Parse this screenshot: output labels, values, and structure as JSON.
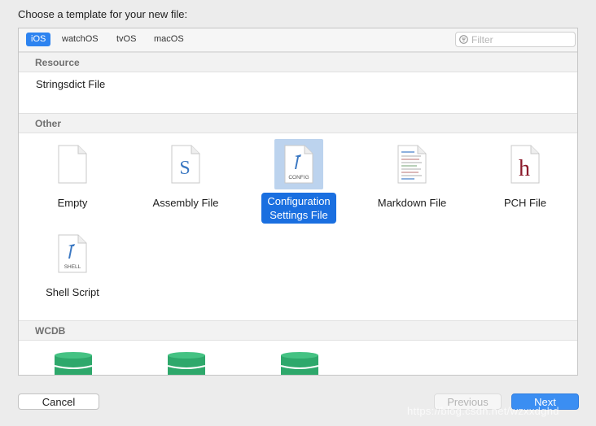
{
  "prompt": "Choose a template for your new file:",
  "platforms": [
    {
      "label": "iOS",
      "selected": true
    },
    {
      "label": "watchOS",
      "selected": false
    },
    {
      "label": "tvOS",
      "selected": false
    },
    {
      "label": "macOS",
      "selected": false
    }
  ],
  "filter": {
    "placeholder": "Filter",
    "value": ""
  },
  "sections": {
    "resource": {
      "title": "Resource",
      "items": [
        "Stringsdict File"
      ]
    },
    "other": {
      "title": "Other",
      "templates": [
        {
          "label": "Empty",
          "icon": "empty-file-icon"
        },
        {
          "label": "Assembly File",
          "icon": "assembly-file-icon",
          "glyph": "S"
        },
        {
          "label_line1": "Configuration",
          "label_line2": "Settings File",
          "icon": "config-file-icon",
          "caption": "CONFIG",
          "selected": true
        },
        {
          "label": "Markdown File",
          "icon": "markdown-file-icon"
        },
        {
          "label": "PCH File",
          "icon": "pch-file-icon",
          "glyph": "h"
        },
        {
          "label": "Shell Script",
          "icon": "shell-script-icon",
          "caption": "SHELL"
        }
      ]
    },
    "wcdb": {
      "title": "WCDB",
      "items": [
        "database-icon",
        "database-icon",
        "database-icon"
      ]
    }
  },
  "buttons": {
    "cancel": "Cancel",
    "previous": "Previous",
    "next": "Next"
  },
  "watermark": "https://blog.csdn.net/wzxxdghd",
  "colors": {
    "accent": "#2d83f0",
    "selection": "#1a6fe0",
    "database": "#2ea86b"
  }
}
